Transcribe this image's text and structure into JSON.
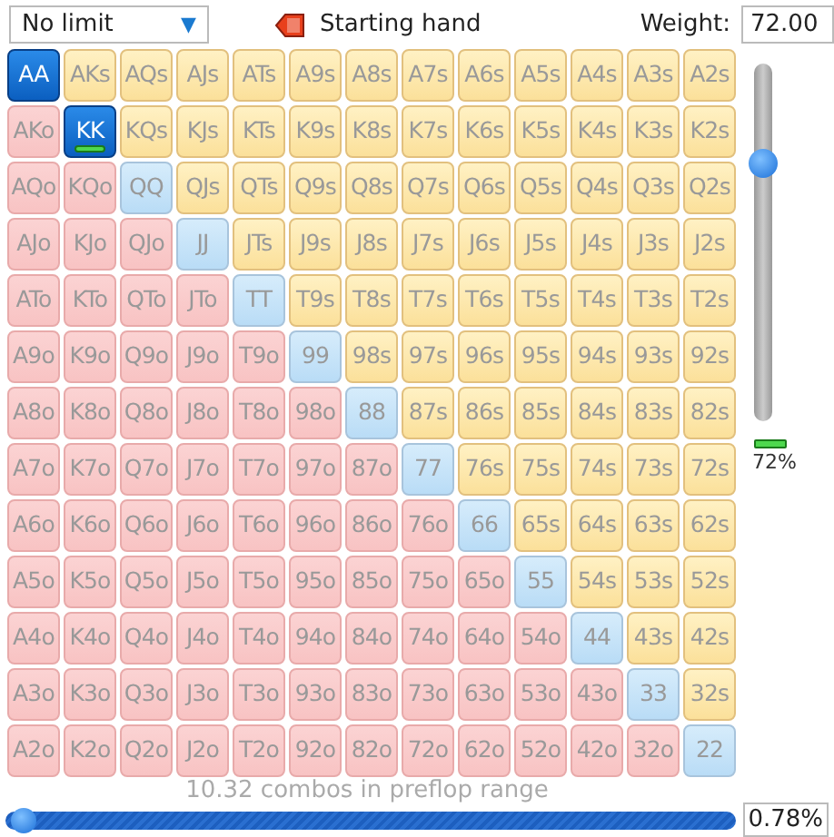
{
  "toolbar": {
    "limit_select": {
      "value": "No limit",
      "arrow": "▼"
    },
    "starting_hand": "Starting hand",
    "weight_label": "Weight:",
    "weight_value": "72.00"
  },
  "grid": [
    [
      {
        "label": "AA",
        "kind": "pair",
        "selected": true,
        "marker": false
      },
      {
        "label": "AKs",
        "kind": "suited",
        "selected": false,
        "marker": false
      },
      {
        "label": "AQs",
        "kind": "suited",
        "selected": false,
        "marker": false
      },
      {
        "label": "AJs",
        "kind": "suited",
        "selected": false,
        "marker": false
      },
      {
        "label": "ATs",
        "kind": "suited",
        "selected": false,
        "marker": false
      },
      {
        "label": "A9s",
        "kind": "suited",
        "selected": false,
        "marker": false
      },
      {
        "label": "A8s",
        "kind": "suited",
        "selected": false,
        "marker": false
      },
      {
        "label": "A7s",
        "kind": "suited",
        "selected": false,
        "marker": false
      },
      {
        "label": "A6s",
        "kind": "suited",
        "selected": false,
        "marker": false
      },
      {
        "label": "A5s",
        "kind": "suited",
        "selected": false,
        "marker": false
      },
      {
        "label": "A4s",
        "kind": "suited",
        "selected": false,
        "marker": false
      },
      {
        "label": "A3s",
        "kind": "suited",
        "selected": false,
        "marker": false
      },
      {
        "label": "A2s",
        "kind": "suited",
        "selected": false,
        "marker": false
      }
    ],
    [
      {
        "label": "AKo",
        "kind": "offsuit",
        "selected": false,
        "marker": false
      },
      {
        "label": "KK",
        "kind": "pair",
        "selected": true,
        "marker": true
      },
      {
        "label": "KQs",
        "kind": "suited",
        "selected": false,
        "marker": false
      },
      {
        "label": "KJs",
        "kind": "suited",
        "selected": false,
        "marker": false
      },
      {
        "label": "KTs",
        "kind": "suited",
        "selected": false,
        "marker": false
      },
      {
        "label": "K9s",
        "kind": "suited",
        "selected": false,
        "marker": false
      },
      {
        "label": "K8s",
        "kind": "suited",
        "selected": false,
        "marker": false
      },
      {
        "label": "K7s",
        "kind": "suited",
        "selected": false,
        "marker": false
      },
      {
        "label": "K6s",
        "kind": "suited",
        "selected": false,
        "marker": false
      },
      {
        "label": "K5s",
        "kind": "suited",
        "selected": false,
        "marker": false
      },
      {
        "label": "K4s",
        "kind": "suited",
        "selected": false,
        "marker": false
      },
      {
        "label": "K3s",
        "kind": "suited",
        "selected": false,
        "marker": false
      },
      {
        "label": "K2s",
        "kind": "suited",
        "selected": false,
        "marker": false
      }
    ],
    [
      {
        "label": "AQo",
        "kind": "offsuit",
        "selected": false,
        "marker": false
      },
      {
        "label": "KQo",
        "kind": "offsuit",
        "selected": false,
        "marker": false
      },
      {
        "label": "QQ",
        "kind": "pair",
        "selected": false,
        "marker": false
      },
      {
        "label": "QJs",
        "kind": "suited",
        "selected": false,
        "marker": false
      },
      {
        "label": "QTs",
        "kind": "suited",
        "selected": false,
        "marker": false
      },
      {
        "label": "Q9s",
        "kind": "suited",
        "selected": false,
        "marker": false
      },
      {
        "label": "Q8s",
        "kind": "suited",
        "selected": false,
        "marker": false
      },
      {
        "label": "Q7s",
        "kind": "suited",
        "selected": false,
        "marker": false
      },
      {
        "label": "Q6s",
        "kind": "suited",
        "selected": false,
        "marker": false
      },
      {
        "label": "Q5s",
        "kind": "suited",
        "selected": false,
        "marker": false
      },
      {
        "label": "Q4s",
        "kind": "suited",
        "selected": false,
        "marker": false
      },
      {
        "label": "Q3s",
        "kind": "suited",
        "selected": false,
        "marker": false
      },
      {
        "label": "Q2s",
        "kind": "suited",
        "selected": false,
        "marker": false
      }
    ],
    [
      {
        "label": "AJo",
        "kind": "offsuit",
        "selected": false,
        "marker": false
      },
      {
        "label": "KJo",
        "kind": "offsuit",
        "selected": false,
        "marker": false
      },
      {
        "label": "QJo",
        "kind": "offsuit",
        "selected": false,
        "marker": false
      },
      {
        "label": "JJ",
        "kind": "pair",
        "selected": false,
        "marker": false
      },
      {
        "label": "JTs",
        "kind": "suited",
        "selected": false,
        "marker": false
      },
      {
        "label": "J9s",
        "kind": "suited",
        "selected": false,
        "marker": false
      },
      {
        "label": "J8s",
        "kind": "suited",
        "selected": false,
        "marker": false
      },
      {
        "label": "J7s",
        "kind": "suited",
        "selected": false,
        "marker": false
      },
      {
        "label": "J6s",
        "kind": "suited",
        "selected": false,
        "marker": false
      },
      {
        "label": "J5s",
        "kind": "suited",
        "selected": false,
        "marker": false
      },
      {
        "label": "J4s",
        "kind": "suited",
        "selected": false,
        "marker": false
      },
      {
        "label": "J3s",
        "kind": "suited",
        "selected": false,
        "marker": false
      },
      {
        "label": "J2s",
        "kind": "suited",
        "selected": false,
        "marker": false
      }
    ],
    [
      {
        "label": "ATo",
        "kind": "offsuit",
        "selected": false,
        "marker": false
      },
      {
        "label": "KTo",
        "kind": "offsuit",
        "selected": false,
        "marker": false
      },
      {
        "label": "QTo",
        "kind": "offsuit",
        "selected": false,
        "marker": false
      },
      {
        "label": "JTo",
        "kind": "offsuit",
        "selected": false,
        "marker": false
      },
      {
        "label": "TT",
        "kind": "pair",
        "selected": false,
        "marker": false
      },
      {
        "label": "T9s",
        "kind": "suited",
        "selected": false,
        "marker": false
      },
      {
        "label": "T8s",
        "kind": "suited",
        "selected": false,
        "marker": false
      },
      {
        "label": "T7s",
        "kind": "suited",
        "selected": false,
        "marker": false
      },
      {
        "label": "T6s",
        "kind": "suited",
        "selected": false,
        "marker": false
      },
      {
        "label": "T5s",
        "kind": "suited",
        "selected": false,
        "marker": false
      },
      {
        "label": "T4s",
        "kind": "suited",
        "selected": false,
        "marker": false
      },
      {
        "label": "T3s",
        "kind": "suited",
        "selected": false,
        "marker": false
      },
      {
        "label": "T2s",
        "kind": "suited",
        "selected": false,
        "marker": false
      }
    ],
    [
      {
        "label": "A9o",
        "kind": "offsuit",
        "selected": false,
        "marker": false
      },
      {
        "label": "K9o",
        "kind": "offsuit",
        "selected": false,
        "marker": false
      },
      {
        "label": "Q9o",
        "kind": "offsuit",
        "selected": false,
        "marker": false
      },
      {
        "label": "J9o",
        "kind": "offsuit",
        "selected": false,
        "marker": false
      },
      {
        "label": "T9o",
        "kind": "offsuit",
        "selected": false,
        "marker": false
      },
      {
        "label": "99",
        "kind": "pair",
        "selected": false,
        "marker": false
      },
      {
        "label": "98s",
        "kind": "suited",
        "selected": false,
        "marker": false
      },
      {
        "label": "97s",
        "kind": "suited",
        "selected": false,
        "marker": false
      },
      {
        "label": "96s",
        "kind": "suited",
        "selected": false,
        "marker": false
      },
      {
        "label": "95s",
        "kind": "suited",
        "selected": false,
        "marker": false
      },
      {
        "label": "94s",
        "kind": "suited",
        "selected": false,
        "marker": false
      },
      {
        "label": "93s",
        "kind": "suited",
        "selected": false,
        "marker": false
      },
      {
        "label": "92s",
        "kind": "suited",
        "selected": false,
        "marker": false
      }
    ],
    [
      {
        "label": "A8o",
        "kind": "offsuit",
        "selected": false,
        "marker": false
      },
      {
        "label": "K8o",
        "kind": "offsuit",
        "selected": false,
        "marker": false
      },
      {
        "label": "Q8o",
        "kind": "offsuit",
        "selected": false,
        "marker": false
      },
      {
        "label": "J8o",
        "kind": "offsuit",
        "selected": false,
        "marker": false
      },
      {
        "label": "T8o",
        "kind": "offsuit",
        "selected": false,
        "marker": false
      },
      {
        "label": "98o",
        "kind": "offsuit",
        "selected": false,
        "marker": false
      },
      {
        "label": "88",
        "kind": "pair",
        "selected": false,
        "marker": false
      },
      {
        "label": "87s",
        "kind": "suited",
        "selected": false,
        "marker": false
      },
      {
        "label": "86s",
        "kind": "suited",
        "selected": false,
        "marker": false
      },
      {
        "label": "85s",
        "kind": "suited",
        "selected": false,
        "marker": false
      },
      {
        "label": "84s",
        "kind": "suited",
        "selected": false,
        "marker": false
      },
      {
        "label": "83s",
        "kind": "suited",
        "selected": false,
        "marker": false
      },
      {
        "label": "82s",
        "kind": "suited",
        "selected": false,
        "marker": false
      }
    ],
    [
      {
        "label": "A7o",
        "kind": "offsuit",
        "selected": false,
        "marker": false
      },
      {
        "label": "K7o",
        "kind": "offsuit",
        "selected": false,
        "marker": false
      },
      {
        "label": "Q7o",
        "kind": "offsuit",
        "selected": false,
        "marker": false
      },
      {
        "label": "J7o",
        "kind": "offsuit",
        "selected": false,
        "marker": false
      },
      {
        "label": "T7o",
        "kind": "offsuit",
        "selected": false,
        "marker": false
      },
      {
        "label": "97o",
        "kind": "offsuit",
        "selected": false,
        "marker": false
      },
      {
        "label": "87o",
        "kind": "offsuit",
        "selected": false,
        "marker": false
      },
      {
        "label": "77",
        "kind": "pair",
        "selected": false,
        "marker": false
      },
      {
        "label": "76s",
        "kind": "suited",
        "selected": false,
        "marker": false
      },
      {
        "label": "75s",
        "kind": "suited",
        "selected": false,
        "marker": false
      },
      {
        "label": "74s",
        "kind": "suited",
        "selected": false,
        "marker": false
      },
      {
        "label": "73s",
        "kind": "suited",
        "selected": false,
        "marker": false
      },
      {
        "label": "72s",
        "kind": "suited",
        "selected": false,
        "marker": false
      }
    ],
    [
      {
        "label": "A6o",
        "kind": "offsuit",
        "selected": false,
        "marker": false
      },
      {
        "label": "K6o",
        "kind": "offsuit",
        "selected": false,
        "marker": false
      },
      {
        "label": "Q6o",
        "kind": "offsuit",
        "selected": false,
        "marker": false
      },
      {
        "label": "J6o",
        "kind": "offsuit",
        "selected": false,
        "marker": false
      },
      {
        "label": "T6o",
        "kind": "offsuit",
        "selected": false,
        "marker": false
      },
      {
        "label": "96o",
        "kind": "offsuit",
        "selected": false,
        "marker": false
      },
      {
        "label": "86o",
        "kind": "offsuit",
        "selected": false,
        "marker": false
      },
      {
        "label": "76o",
        "kind": "offsuit",
        "selected": false,
        "marker": false
      },
      {
        "label": "66",
        "kind": "pair",
        "selected": false,
        "marker": false
      },
      {
        "label": "65s",
        "kind": "suited",
        "selected": false,
        "marker": false
      },
      {
        "label": "64s",
        "kind": "suited",
        "selected": false,
        "marker": false
      },
      {
        "label": "63s",
        "kind": "suited",
        "selected": false,
        "marker": false
      },
      {
        "label": "62s",
        "kind": "suited",
        "selected": false,
        "marker": false
      }
    ],
    [
      {
        "label": "A5o",
        "kind": "offsuit",
        "selected": false,
        "marker": false
      },
      {
        "label": "K5o",
        "kind": "offsuit",
        "selected": false,
        "marker": false
      },
      {
        "label": "Q5o",
        "kind": "offsuit",
        "selected": false,
        "marker": false
      },
      {
        "label": "J5o",
        "kind": "offsuit",
        "selected": false,
        "marker": false
      },
      {
        "label": "T5o",
        "kind": "offsuit",
        "selected": false,
        "marker": false
      },
      {
        "label": "95o",
        "kind": "offsuit",
        "selected": false,
        "marker": false
      },
      {
        "label": "85o",
        "kind": "offsuit",
        "selected": false,
        "marker": false
      },
      {
        "label": "75o",
        "kind": "offsuit",
        "selected": false,
        "marker": false
      },
      {
        "label": "65o",
        "kind": "offsuit",
        "selected": false,
        "marker": false
      },
      {
        "label": "55",
        "kind": "pair",
        "selected": false,
        "marker": false
      },
      {
        "label": "54s",
        "kind": "suited",
        "selected": false,
        "marker": false
      },
      {
        "label": "53s",
        "kind": "suited",
        "selected": false,
        "marker": false
      },
      {
        "label": "52s",
        "kind": "suited",
        "selected": false,
        "marker": false
      }
    ],
    [
      {
        "label": "A4o",
        "kind": "offsuit",
        "selected": false,
        "marker": false
      },
      {
        "label": "K4o",
        "kind": "offsuit",
        "selected": false,
        "marker": false
      },
      {
        "label": "Q4o",
        "kind": "offsuit",
        "selected": false,
        "marker": false
      },
      {
        "label": "J4o",
        "kind": "offsuit",
        "selected": false,
        "marker": false
      },
      {
        "label": "T4o",
        "kind": "offsuit",
        "selected": false,
        "marker": false
      },
      {
        "label": "94o",
        "kind": "offsuit",
        "selected": false,
        "marker": false
      },
      {
        "label": "84o",
        "kind": "offsuit",
        "selected": false,
        "marker": false
      },
      {
        "label": "74o",
        "kind": "offsuit",
        "selected": false,
        "marker": false
      },
      {
        "label": "64o",
        "kind": "offsuit",
        "selected": false,
        "marker": false
      },
      {
        "label": "54o",
        "kind": "offsuit",
        "selected": false,
        "marker": false
      },
      {
        "label": "44",
        "kind": "pair",
        "selected": false,
        "marker": false
      },
      {
        "label": "43s",
        "kind": "suited",
        "selected": false,
        "marker": false
      },
      {
        "label": "42s",
        "kind": "suited",
        "selected": false,
        "marker": false
      }
    ],
    [
      {
        "label": "A3o",
        "kind": "offsuit",
        "selected": false,
        "marker": false
      },
      {
        "label": "K3o",
        "kind": "offsuit",
        "selected": false,
        "marker": false
      },
      {
        "label": "Q3o",
        "kind": "offsuit",
        "selected": false,
        "marker": false
      },
      {
        "label": "J3o",
        "kind": "offsuit",
        "selected": false,
        "marker": false
      },
      {
        "label": "T3o",
        "kind": "offsuit",
        "selected": false,
        "marker": false
      },
      {
        "label": "93o",
        "kind": "offsuit",
        "selected": false,
        "marker": false
      },
      {
        "label": "83o",
        "kind": "offsuit",
        "selected": false,
        "marker": false
      },
      {
        "label": "73o",
        "kind": "offsuit",
        "selected": false,
        "marker": false
      },
      {
        "label": "63o",
        "kind": "offsuit",
        "selected": false,
        "marker": false
      },
      {
        "label": "53o",
        "kind": "offsuit",
        "selected": false,
        "marker": false
      },
      {
        "label": "43o",
        "kind": "offsuit",
        "selected": false,
        "marker": false
      },
      {
        "label": "33",
        "kind": "pair",
        "selected": false,
        "marker": false
      },
      {
        "label": "32s",
        "kind": "suited",
        "selected": false,
        "marker": false
      }
    ],
    [
      {
        "label": "A2o",
        "kind": "offsuit",
        "selected": false,
        "marker": false
      },
      {
        "label": "K2o",
        "kind": "offsuit",
        "selected": false,
        "marker": false
      },
      {
        "label": "Q2o",
        "kind": "offsuit",
        "selected": false,
        "marker": false
      },
      {
        "label": "J2o",
        "kind": "offsuit",
        "selected": false,
        "marker": false
      },
      {
        "label": "T2o",
        "kind": "offsuit",
        "selected": false,
        "marker": false
      },
      {
        "label": "92o",
        "kind": "offsuit",
        "selected": false,
        "marker": false
      },
      {
        "label": "82o",
        "kind": "offsuit",
        "selected": false,
        "marker": false
      },
      {
        "label": "72o",
        "kind": "offsuit",
        "selected": false,
        "marker": false
      },
      {
        "label": "62o",
        "kind": "offsuit",
        "selected": false,
        "marker": false
      },
      {
        "label": "52o",
        "kind": "offsuit",
        "selected": false,
        "marker": false
      },
      {
        "label": "42o",
        "kind": "offsuit",
        "selected": false,
        "marker": false
      },
      {
        "label": "32o",
        "kind": "offsuit",
        "selected": false,
        "marker": false
      },
      {
        "label": "22",
        "kind": "pair",
        "selected": false,
        "marker": false
      }
    ]
  ],
  "weight_slider": {
    "level": 0.72,
    "reading": "72%"
  },
  "range": {
    "caption": "10.32 combos in preflop range",
    "level": 0.0078,
    "value": "0.78%"
  }
}
